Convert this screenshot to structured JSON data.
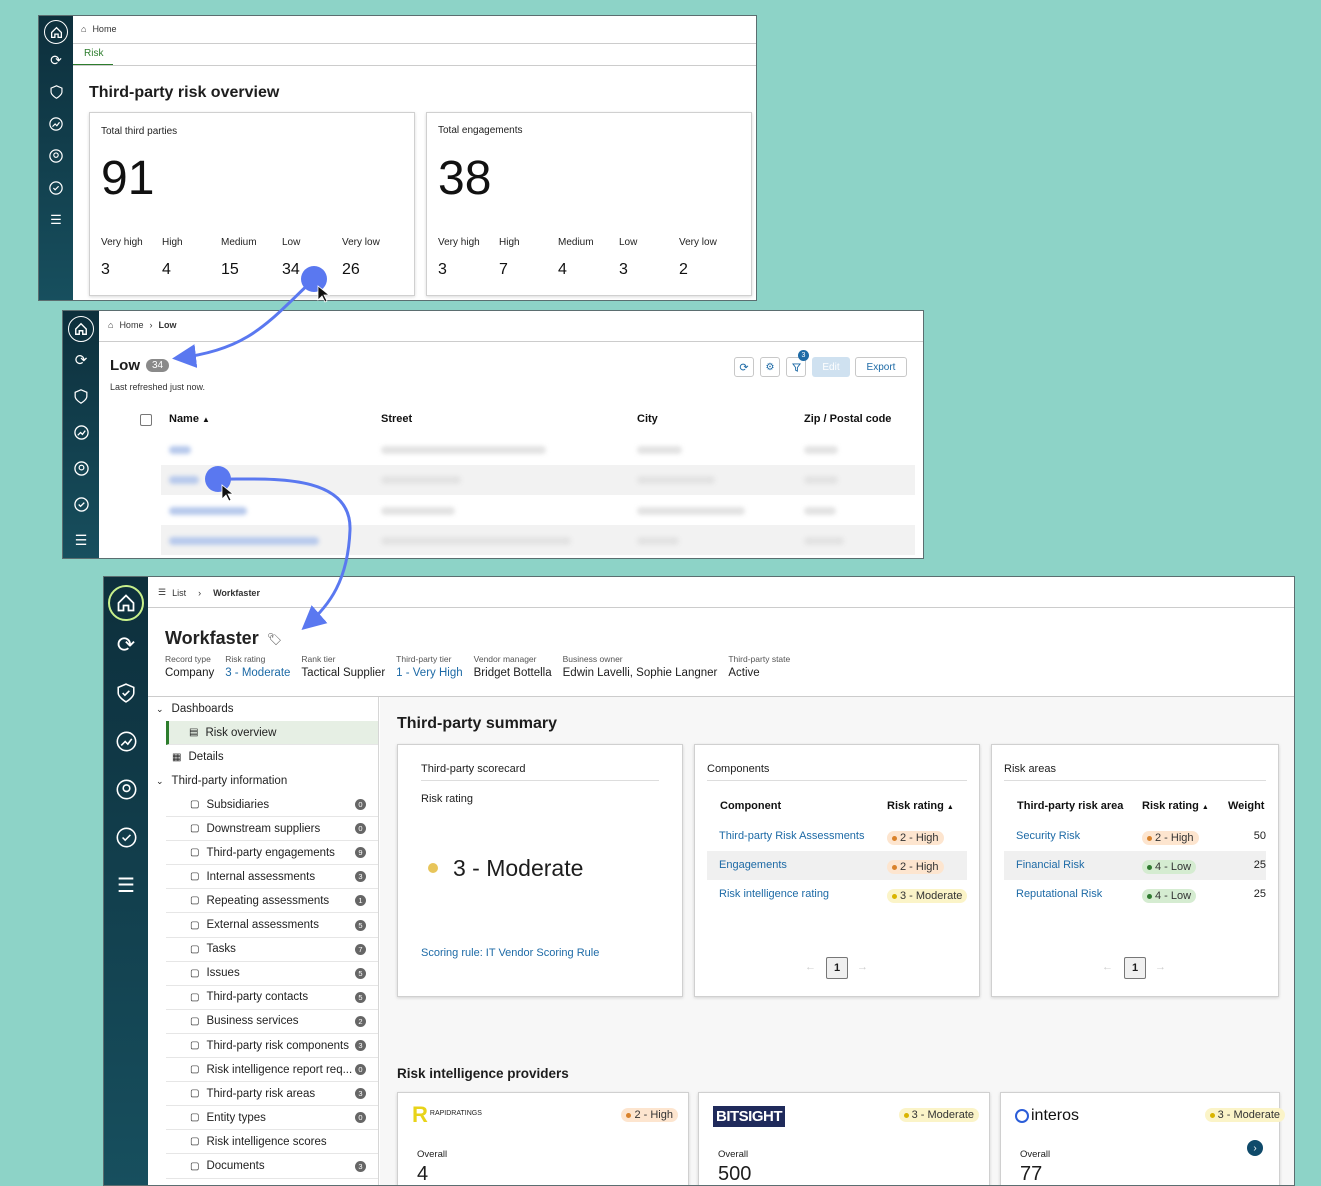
{
  "screen1": {
    "breadcrumb_home": "Home",
    "tab": "Risk",
    "title": "Third-party risk overview",
    "cards": [
      {
        "label": "Total third parties",
        "total": "91",
        "levels": [
          {
            "name": "Very high",
            "value": "3"
          },
          {
            "name": "High",
            "value": "4"
          },
          {
            "name": "Medium",
            "value": "15"
          },
          {
            "name": "Low",
            "value": "34"
          },
          {
            "name": "Very low",
            "value": "26"
          }
        ]
      },
      {
        "label": "Total engagements",
        "total": "38",
        "levels": [
          {
            "name": "Very high",
            "value": "3"
          },
          {
            "name": "High",
            "value": "7"
          },
          {
            "name": "Medium",
            "value": "4"
          },
          {
            "name": "Low",
            "value": "3"
          },
          {
            "name": "Very low",
            "value": "2"
          }
        ]
      }
    ]
  },
  "screen2": {
    "breadcrumb_home": "Home",
    "breadcrumb_current": "Low",
    "title": "Low",
    "count": "34",
    "refreshed": "Last refreshed just now.",
    "filter_badge": "3",
    "edit_label": "Edit",
    "export_label": "Export",
    "columns": [
      "Name",
      "Street",
      "City",
      "Zip / Postal code"
    ]
  },
  "screen3": {
    "breadcrumb_list": "List",
    "breadcrumb_current": "Workfaster",
    "title": "Workfaster",
    "meta": [
      {
        "label": "Record type",
        "value": "Company"
      },
      {
        "label": "Risk rating",
        "value": "3 - Moderate"
      },
      {
        "label": "Rank tier",
        "value": "Tactical Supplier"
      },
      {
        "label": "Third-party tier",
        "value": "1 - Very High"
      },
      {
        "label": "Vendor manager",
        "value": "Bridget Bottella"
      },
      {
        "label": "Business owner",
        "value": "Edwin Lavelli, Sophie Langner"
      },
      {
        "label": "Third-party state",
        "value": "Active"
      }
    ],
    "nav": {
      "dashboards": "Dashboards",
      "risk_overview": "Risk overview",
      "details": "Details",
      "third_party_info": "Third-party information",
      "items": [
        {
          "label": "Subsidiaries",
          "count": "0"
        },
        {
          "label": "Downstream suppliers",
          "count": "0"
        },
        {
          "label": "Third-party engagements",
          "count": "9"
        },
        {
          "label": "Internal assessments",
          "count": "3"
        },
        {
          "label": "Repeating assessments",
          "count": "1"
        },
        {
          "label": "External assessments",
          "count": "5"
        },
        {
          "label": "Tasks",
          "count": "7"
        },
        {
          "label": "Issues",
          "count": "5"
        },
        {
          "label": "Third-party contacts",
          "count": "5"
        },
        {
          "label": "Business services",
          "count": "2"
        },
        {
          "label": "Third-party risk components",
          "count": "3"
        },
        {
          "label": "Risk intelligence report req...",
          "count": "0"
        },
        {
          "label": "Third-party risk areas",
          "count": "3"
        },
        {
          "label": "Entity types",
          "count": "0"
        },
        {
          "label": "Risk intelligence scores",
          "count": ""
        },
        {
          "label": "Documents",
          "count": "3"
        }
      ]
    },
    "summary_title": "Third-party summary",
    "scorecard": {
      "heading": "Third-party scorecard",
      "rating_label": "Risk rating",
      "rating_value": "3 - Moderate",
      "rule_link": "Scoring rule: IT Vendor Scoring Rule"
    },
    "components": {
      "heading": "Components",
      "col_component": "Component",
      "col_rating": "Risk rating",
      "rows": [
        {
          "name": "Third-party Risk Assessments",
          "rating": "2 - High",
          "level": "high"
        },
        {
          "name": "Engagements",
          "rating": "2 - High",
          "level": "high"
        },
        {
          "name": "Risk intelligence rating",
          "rating": "3 - Moderate",
          "level": "mod"
        }
      ],
      "page": "1"
    },
    "risk_areas": {
      "heading": "Risk areas",
      "col_area": "Third-party risk area",
      "col_rating": "Risk rating",
      "col_weight": "Weight",
      "rows": [
        {
          "name": "Security Risk",
          "rating": "2 - High",
          "level": "high",
          "weight": "50"
        },
        {
          "name": "Financial Risk",
          "rating": "4 - Low",
          "level": "low",
          "weight": "25"
        },
        {
          "name": "Reputational Risk",
          "rating": "4 - Low",
          "level": "low",
          "weight": "25"
        }
      ],
      "page": "1"
    },
    "providers_title": "Risk intelligence providers",
    "providers": [
      {
        "logo": "RAPIDRATINGS",
        "rating": "2 - High",
        "level": "high",
        "overall_label": "Overall",
        "overall": "4"
      },
      {
        "logo": "BITSIGHT",
        "rating": "3 - Moderate",
        "level": "mod",
        "overall_label": "Overall",
        "overall": "500"
      },
      {
        "logo": "interos",
        "rating": "3 - Moderate",
        "level": "mod",
        "overall_label": "Overall",
        "overall": "77"
      }
    ]
  }
}
